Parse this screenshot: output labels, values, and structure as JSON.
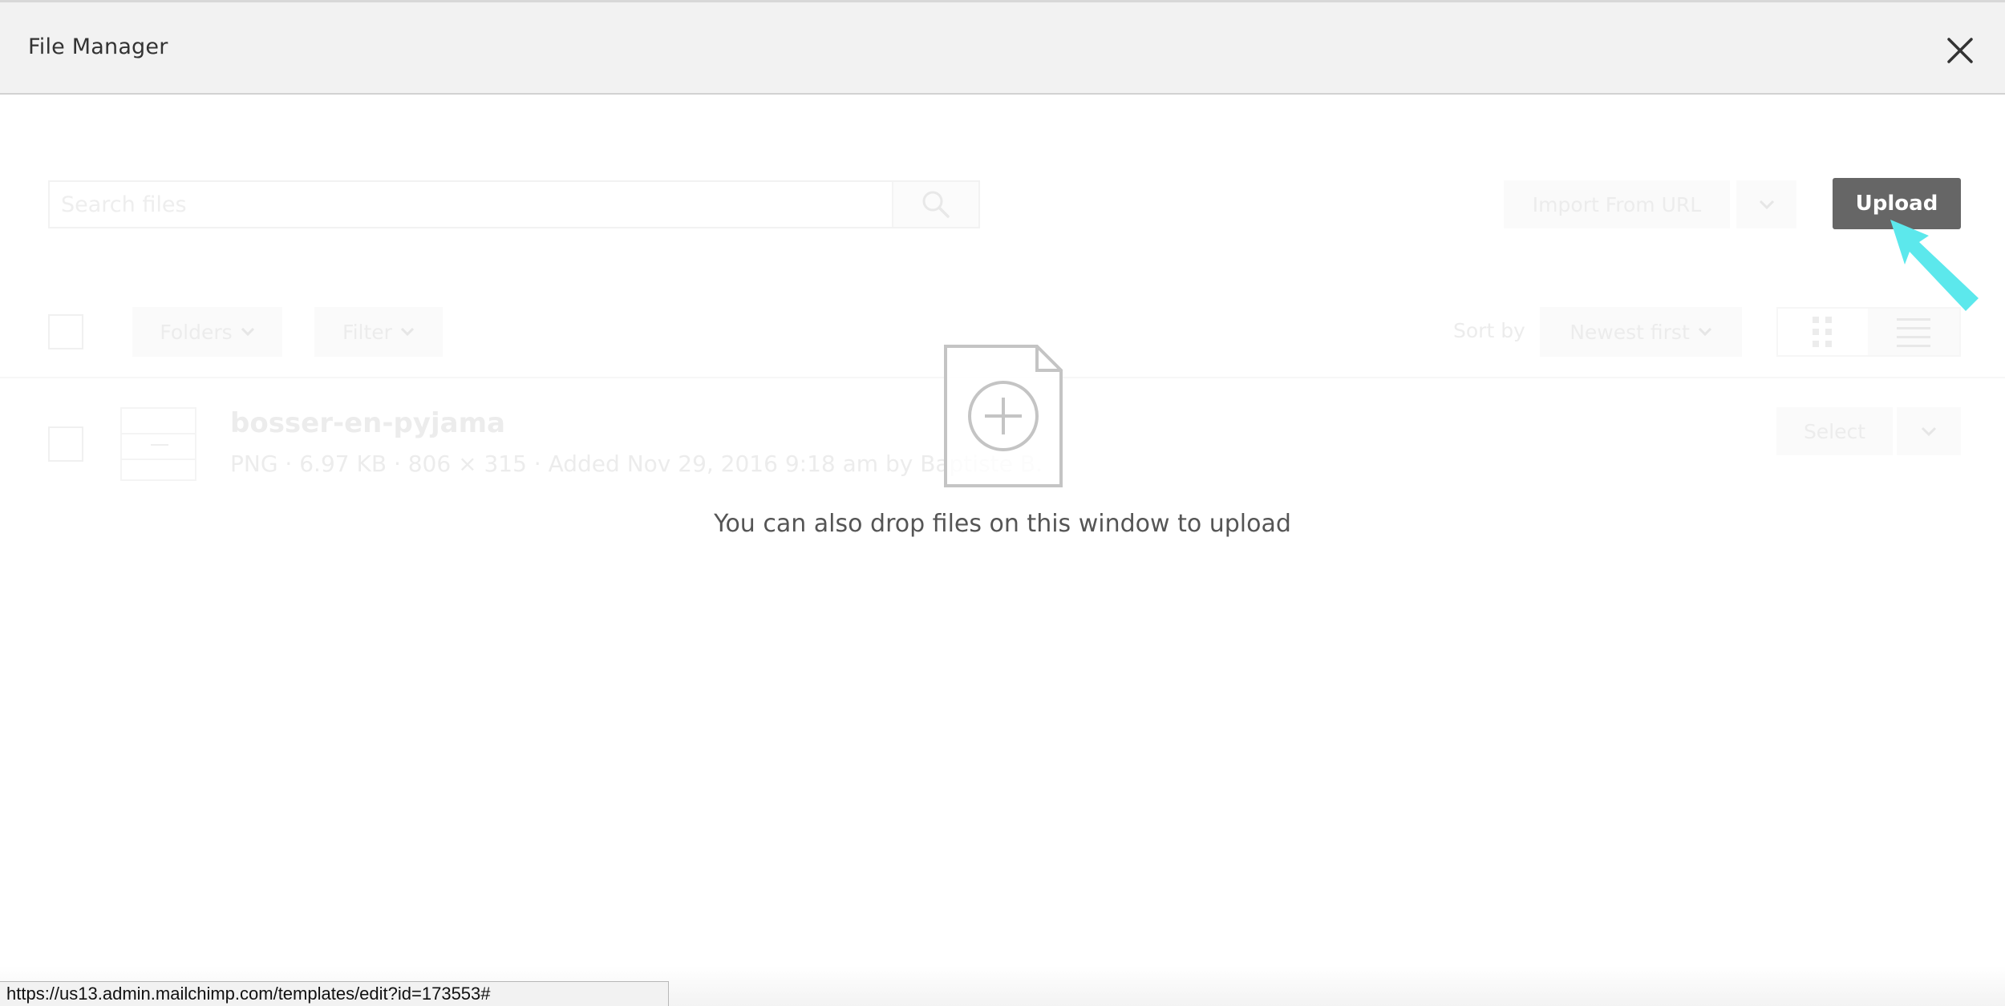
{
  "header": {
    "title": "File Manager"
  },
  "toolbar": {
    "search_placeholder": "Search files",
    "import_label": "Import From URL",
    "upload_label": "Upload"
  },
  "filters": {
    "folders_label": "Folders",
    "filter_label": "Filter",
    "sort_by_label": "Sort by",
    "sort_value": "Newest first"
  },
  "files": [
    {
      "name": "bosser-en-pyjama",
      "meta": "PNG · 6.97 KB · 806 × 315 · Added Nov 29, 2016 9:18 am by Baptiste B.",
      "select_label": "Select"
    }
  ],
  "drop_zone": {
    "message": "You can also drop files on this window to upload"
  },
  "status_bar": {
    "url": "https://us13.admin.mailchimp.com/templates/edit?id=173553#"
  },
  "colors": {
    "upload_button": "#666666",
    "cursor": "#5ce8ec",
    "header_bg": "#f2f2f2"
  }
}
